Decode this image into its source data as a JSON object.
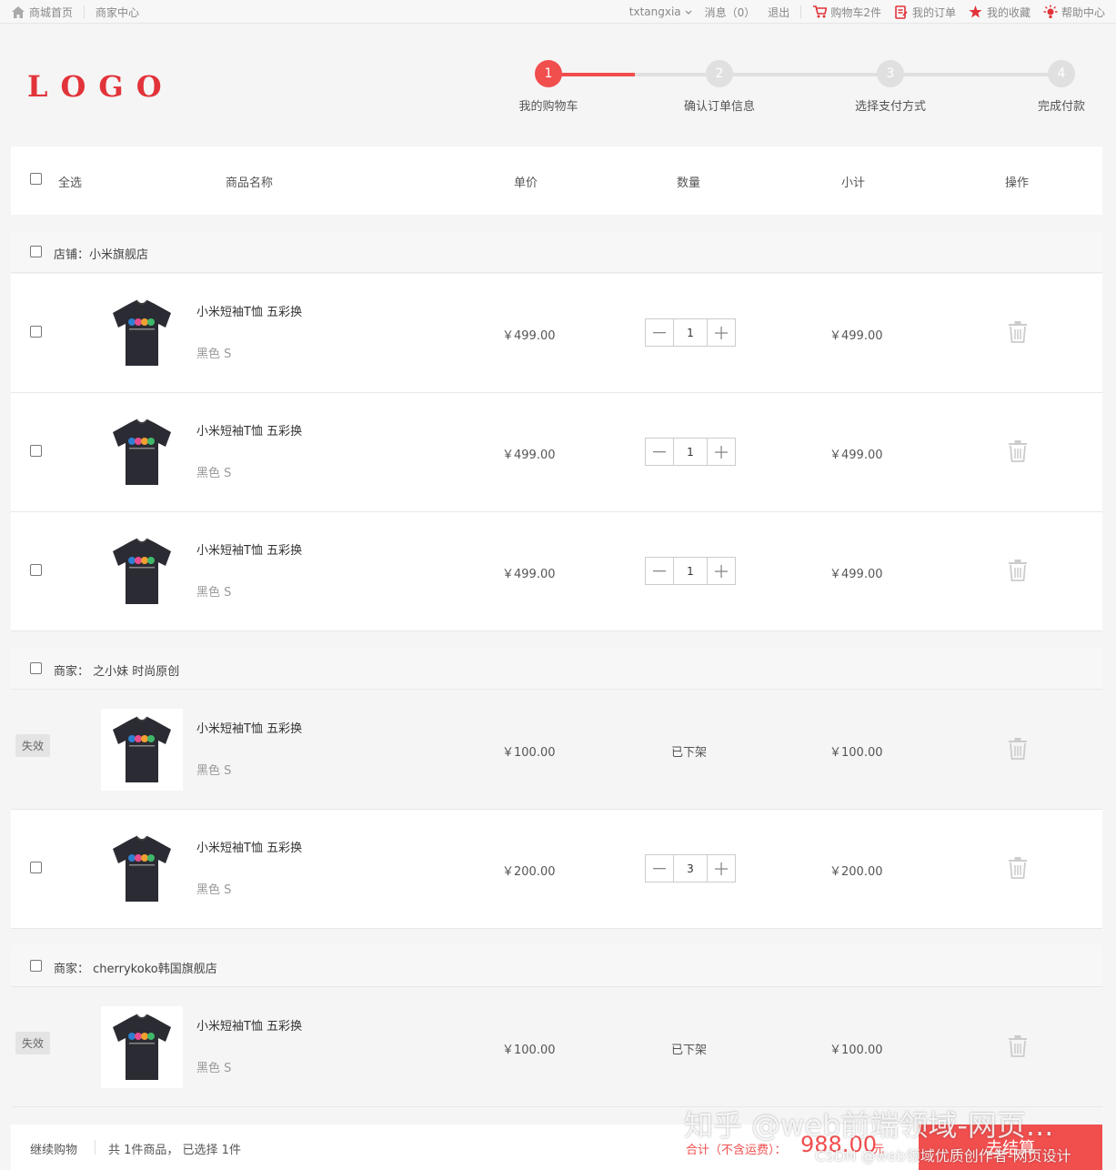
{
  "topbar": {
    "home": "商城首页",
    "merchant": "商家中心",
    "user": "txtangxia",
    "messages": "消息（0）",
    "logout": "退出",
    "cart": "购物车2件",
    "orders": "我的订单",
    "favorites": "我的收藏",
    "help": "帮助中心"
  },
  "logo": "LOGO",
  "steps": [
    {
      "num": "1",
      "label": "我的购物车"
    },
    {
      "num": "2",
      "label": "确认订单信息"
    },
    {
      "num": "3",
      "label": "选择支付方式"
    },
    {
      "num": "4",
      "label": "完成付款"
    }
  ],
  "columns": {
    "select_all": "全选",
    "name": "商品名称",
    "price": "单价",
    "qty": "数量",
    "subtotal": "小计",
    "action": "操作"
  },
  "shops": [
    {
      "label": "店铺：小米旗舰店"
    },
    {
      "label": "商家：  之小妹 时尚原创"
    },
    {
      "label": "商家：  cherrykoko韩国旗舰店"
    }
  ],
  "items": [
    {
      "name": "小米短袖T恤 五彩换",
      "spec": "黑色 S",
      "price": "￥499.00",
      "qty": "1",
      "subtotal": "￥499.00"
    },
    {
      "name": "小米短袖T恤 五彩换",
      "spec": "黑色 S",
      "price": "￥499.00",
      "qty": "1",
      "subtotal": "￥499.00"
    },
    {
      "name": "小米短袖T恤 五彩换",
      "spec": "黑色 S",
      "price": "￥499.00",
      "qty": "1",
      "subtotal": "￥499.00"
    },
    {
      "name": "小米短袖T恤 五彩换",
      "spec": "黑色 S",
      "price": "￥100.00",
      "status": "已下架",
      "badge": "失效",
      "subtotal": "￥100.00"
    },
    {
      "name": "小米短袖T恤 五彩换",
      "spec": "黑色 S",
      "price": "￥200.00",
      "qty": "3",
      "subtotal": "￥200.00"
    },
    {
      "name": "小米短袖T恤 五彩换",
      "spec": "黑色 S",
      "price": "￥100.00",
      "status": "已下架",
      "badge": "失效",
      "subtotal": "￥100.00"
    }
  ],
  "footer": {
    "continue": "继续购物",
    "count": "共 1件商品，  已选择 1件",
    "total_label": "合计（不含运费）：",
    "total_value": "988.00",
    "total_unit": "元",
    "checkout": "去结算"
  },
  "watermark": {
    "zhihu": "知乎 @web前端领域-网页...",
    "csdn": "CSDN @web领域优质创作者-网页设计"
  },
  "colors": {
    "accent": "#f14e4e",
    "logo": "#e2333a"
  },
  "icons": [
    "home-icon",
    "chevron-down-icon",
    "cart-icon",
    "order-icon",
    "star-icon",
    "help-icon",
    "trash-icon",
    "minus-icon",
    "plus-icon",
    "tshirt-image"
  ]
}
